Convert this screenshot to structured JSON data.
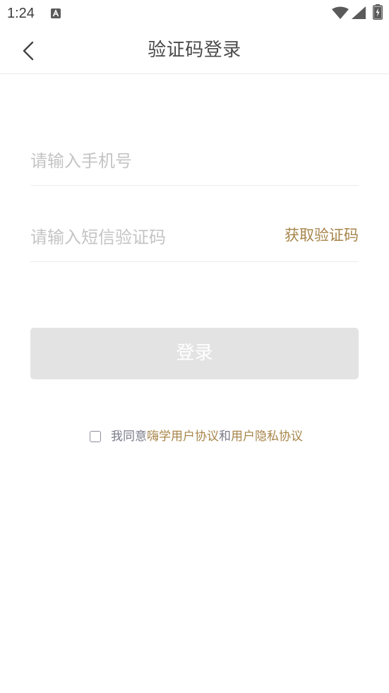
{
  "status_bar": {
    "time": "1:24",
    "icons": [
      "app-notification-icon",
      "wifi-icon",
      "signal-icon",
      "battery-charging-icon"
    ]
  },
  "header": {
    "title": "验证码登录",
    "back_icon": "chevron-left-icon"
  },
  "form": {
    "phone_placeholder": "请输入手机号",
    "phone_value": "",
    "code_placeholder": "请输入短信验证码",
    "code_value": "",
    "get_code_label": "获取验证码",
    "login_label": "登录"
  },
  "agreement": {
    "checked": false,
    "prefix": "我同意",
    "user_agreement": "嗨学用户协议",
    "conjunction": "和",
    "privacy_agreement": "用户隐私协议"
  },
  "colors": {
    "accent": "#a7854a",
    "button_disabled_bg": "#e3e3e3",
    "placeholder": "#c4c4c4",
    "divider": "#ececec"
  }
}
